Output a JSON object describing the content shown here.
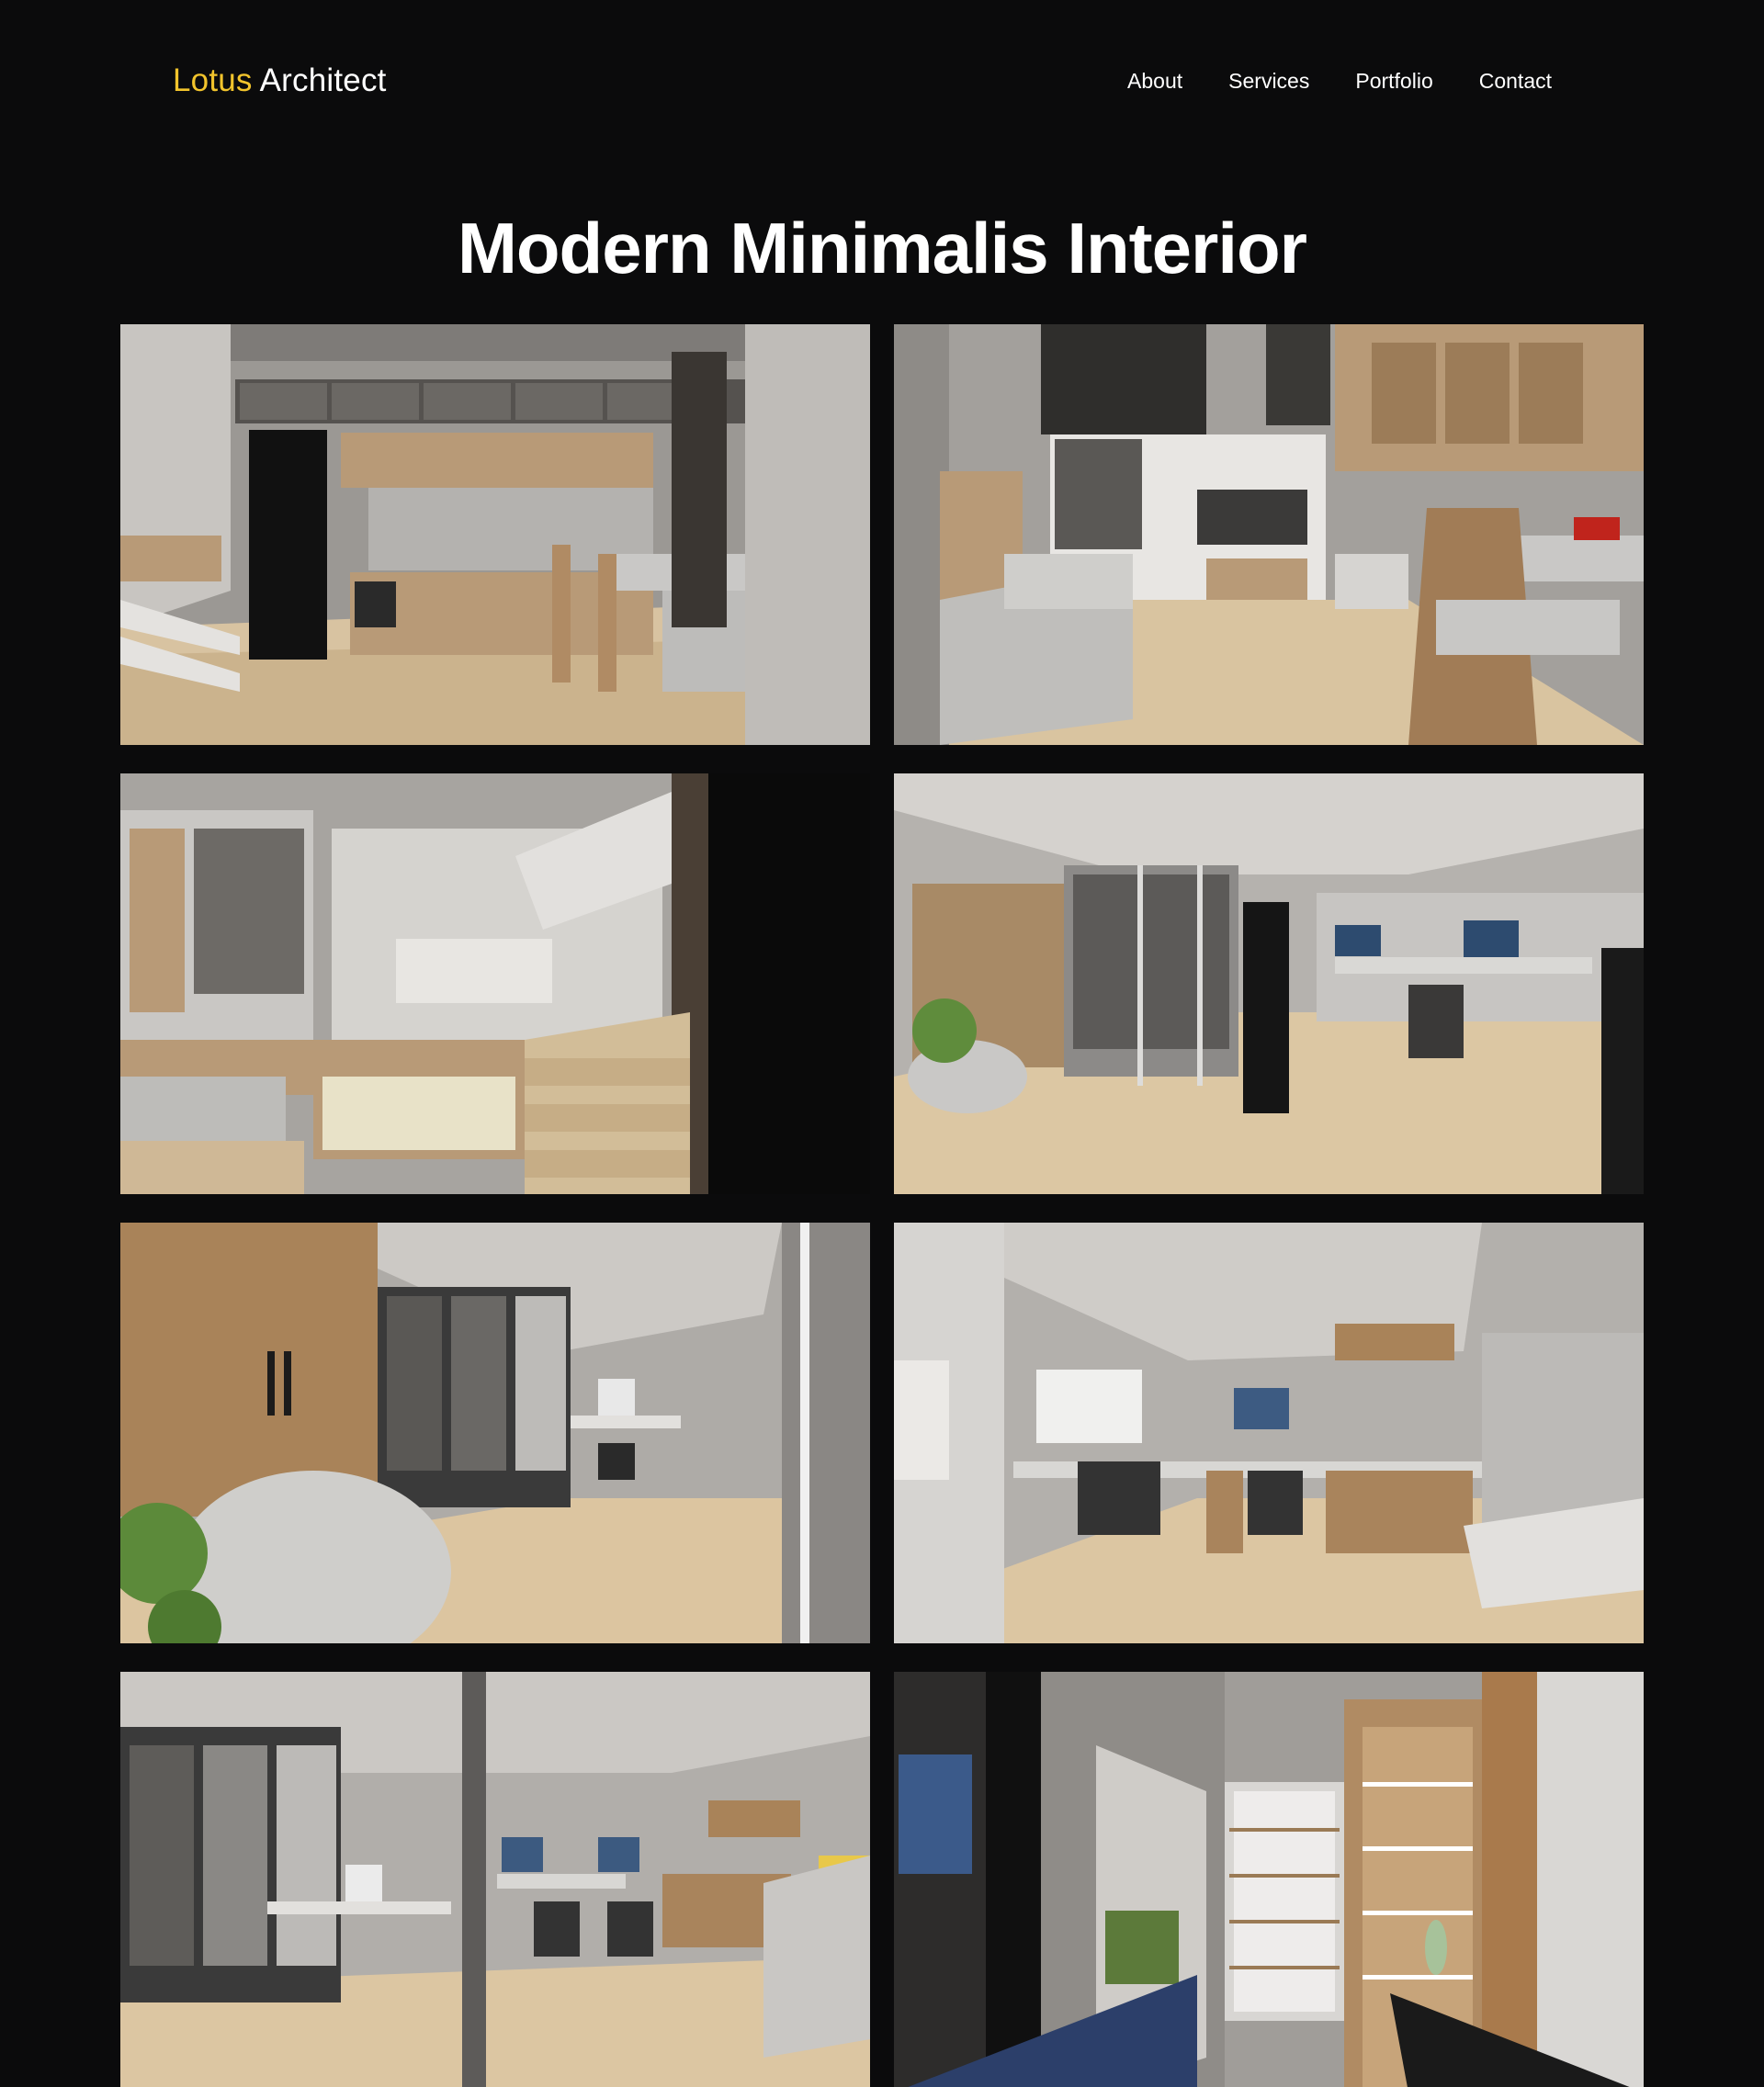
{
  "header": {
    "brand_accent": "Lotus",
    "brand_rest": "Architect",
    "nav": [
      {
        "label": "About"
      },
      {
        "label": "Services"
      },
      {
        "label": "Portfolio"
      },
      {
        "label": "Contact"
      }
    ]
  },
  "page_title": "Modern Minimalis Interior",
  "gallery": {
    "images": [
      {
        "name": "kitchen-render"
      },
      {
        "name": "living-room-render"
      },
      {
        "name": "staircase-shelving-render"
      },
      {
        "name": "study-room-glass-partition-render"
      },
      {
        "name": "reading-corner-render"
      },
      {
        "name": "home-office-desks-render"
      },
      {
        "name": "office-overview-render"
      },
      {
        "name": "closet-shelving-render"
      }
    ]
  },
  "colors": {
    "background": "#0b0b0c",
    "brand_accent": "#f2c42c",
    "text": "#ffffff"
  }
}
